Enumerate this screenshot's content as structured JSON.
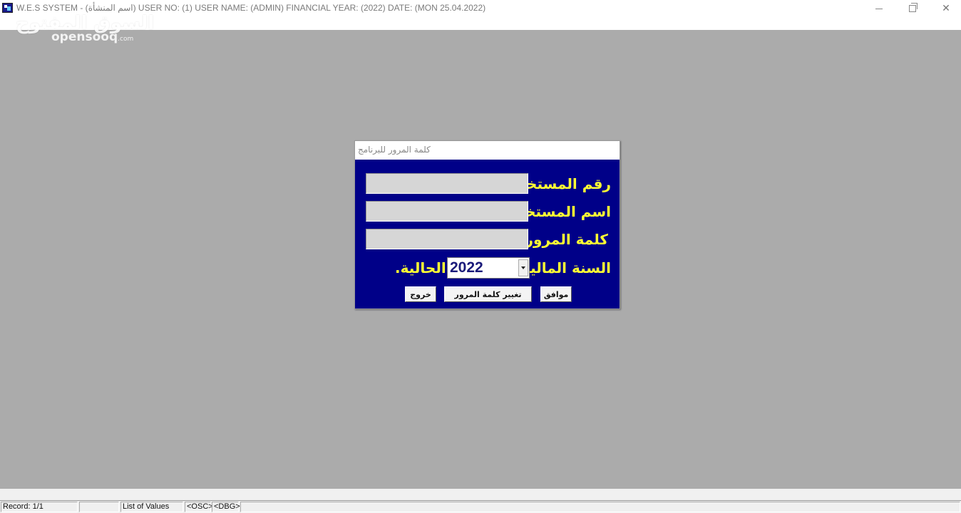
{
  "window": {
    "title": "W.E.S SYSTEM -  (اسم المنشأة)  USER NO: (1) USER NAME: (ADMIN) FINANCIAL YEAR: (2022)  DATE: (MON 25.04.2022)",
    "app_icon": "app-icon",
    "controls": {
      "minimize": "minimize-icon",
      "restore": "restore-icon",
      "close": "close-icon"
    }
  },
  "watermark": {
    "arabic": "السوق المفتوح",
    "english": "opensooq",
    "suffix": ".com"
  },
  "dialog": {
    "title": "كلمة المرور للبرنامج",
    "fields": [
      {
        "label": "رقم المستخدم",
        "value": ""
      },
      {
        "label": "اسم المستخدم",
        "value": ""
      },
      {
        "label": "كلمة المرور",
        "value": ""
      }
    ],
    "year_label": "السنة المالية",
    "year_value": "2022",
    "current_label": "الحالية.",
    "buttons": {
      "ok": "موافق",
      "change_password": "تغيير كلمة المرور",
      "exit": "خروج"
    }
  },
  "statusbar": {
    "record": "Record: 1/1",
    "blank": "",
    "list_of_values": "List of Values",
    "osc": "<OSC>",
    "dbg": "<DBG>"
  },
  "colors": {
    "dialog_bg": "#000088",
    "label_yellow": "#ffff33",
    "desktop_gray": "#ababab"
  }
}
